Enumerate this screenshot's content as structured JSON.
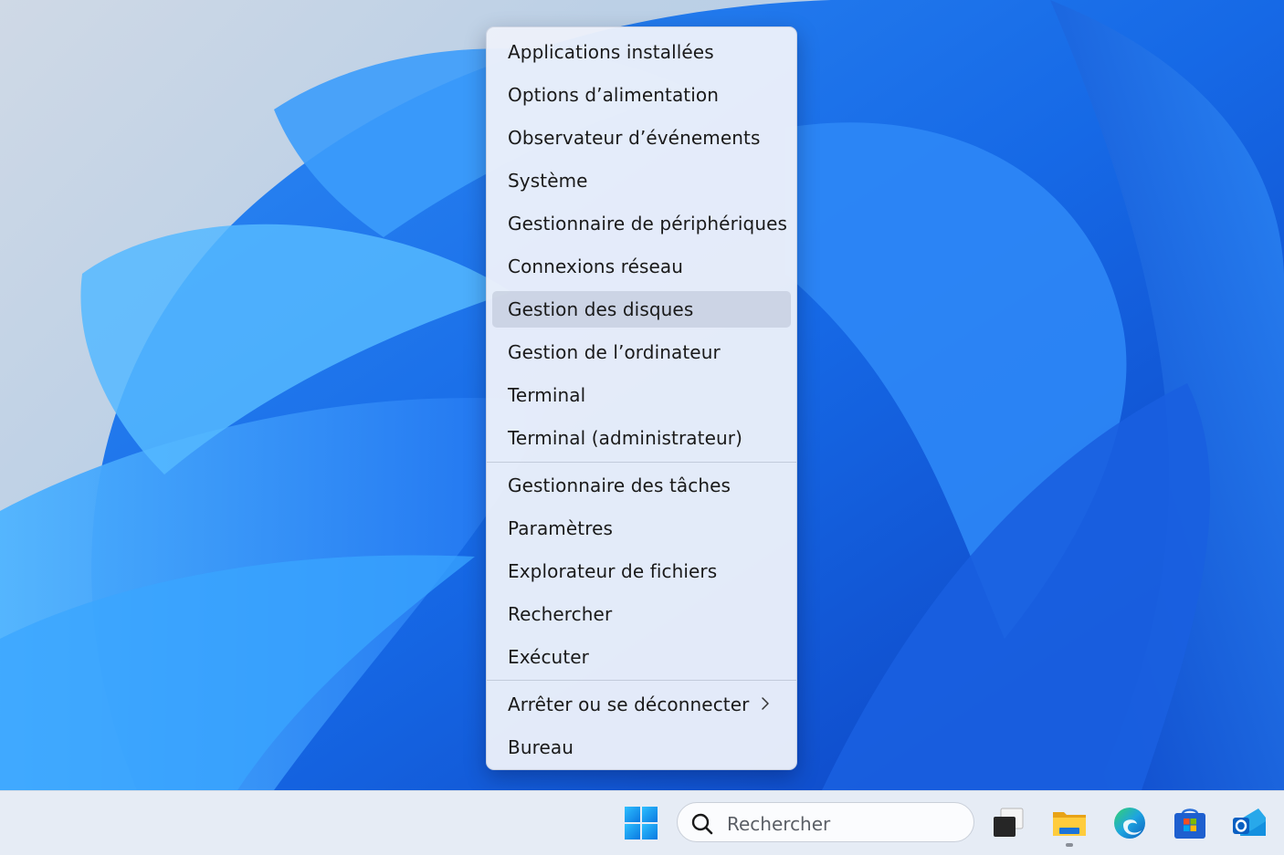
{
  "menu": {
    "groups": [
      [
        "Applications installées",
        "Options d’alimentation",
        "Observateur d’événements",
        "Système",
        "Gestionnaire de périphériques",
        "Connexions réseau",
        "Gestion des disques",
        "Gestion de l’ordinateur",
        "Terminal",
        "Terminal (administrateur)"
      ],
      [
        "Gestionnaire des tâches",
        "Paramètres",
        "Explorateur de fichiers",
        "Rechercher",
        "Exécuter"
      ],
      [
        "Arrêter ou se déconnecter",
        "Bureau"
      ]
    ],
    "highlighted": "Gestion des disques"
  },
  "taskbar": {
    "search_placeholder": "Rechercher",
    "icons": [
      "windows-start-icon",
      "task-view-icon",
      "file-explorer-icon",
      "edge-icon",
      "microsoft-store-icon",
      "outlook-icon"
    ]
  }
}
